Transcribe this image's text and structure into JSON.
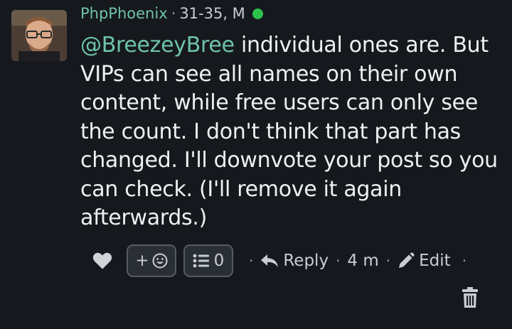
{
  "post": {
    "author": "PhpPhoenix",
    "meta_separator": "·",
    "author_info": "31-35, M",
    "mention": "@BreezeyBree",
    "body": " individual ones are. But VIPs can see all names on their own content, while free users can only see the count. I don't think that part has changed. I'll downvote your post so you can check. (I'll remove it again afterwards.)"
  },
  "actions": {
    "add_reaction_label": "+",
    "reaction_list_count": "0",
    "reply_label": "Reply",
    "time_ago": "4 m",
    "edit_label": "Edit",
    "separator": "·"
  },
  "colors": {
    "background": "#15191e",
    "accent_username": "#6fc3a7",
    "online": "#2ec24d"
  },
  "icons": [
    "heart-icon",
    "smiley-icon",
    "list-icon",
    "reply-arrow-icon",
    "pencil-icon",
    "trash-icon"
  ]
}
